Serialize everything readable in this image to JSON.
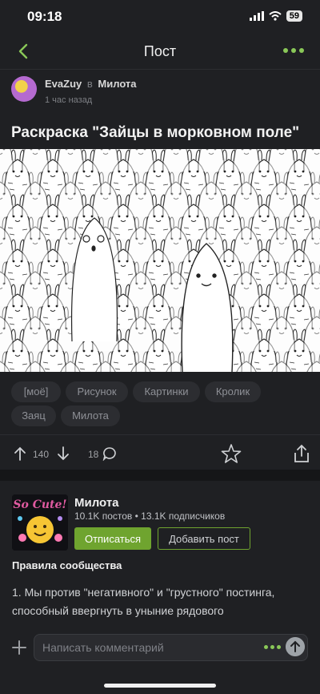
{
  "status_bar": {
    "time": "09:18",
    "battery": "59"
  },
  "nav": {
    "title": "Пост"
  },
  "post": {
    "author": "EvaZuy",
    "in_word": "в",
    "community": "Милота",
    "time_ago": "1 час назад",
    "title": "Раскраска \"Зайцы в морковном поле\"",
    "tags": [
      "[моё]",
      "Рисунок",
      "Картинки",
      "Кролик",
      "Заяц",
      "Милота"
    ],
    "rating": "140",
    "comments_count": "18"
  },
  "community_card": {
    "name": "Милота",
    "stats": "10.1K постов • 13.1K подписчиков",
    "unsubscribe_label": "Отписаться",
    "add_post_label": "Добавить пост",
    "logo_text": "So Cute!",
    "rules_title": "Правила сообщества",
    "rules_text": "1. Мы против \"негативного\" и \"грустного\" постинга, способный ввергнуть в уныние рядового"
  },
  "comment": {
    "placeholder": "Написать комментарий"
  },
  "colors": {
    "accent": "#6fa42f",
    "background": "#1f2023"
  }
}
